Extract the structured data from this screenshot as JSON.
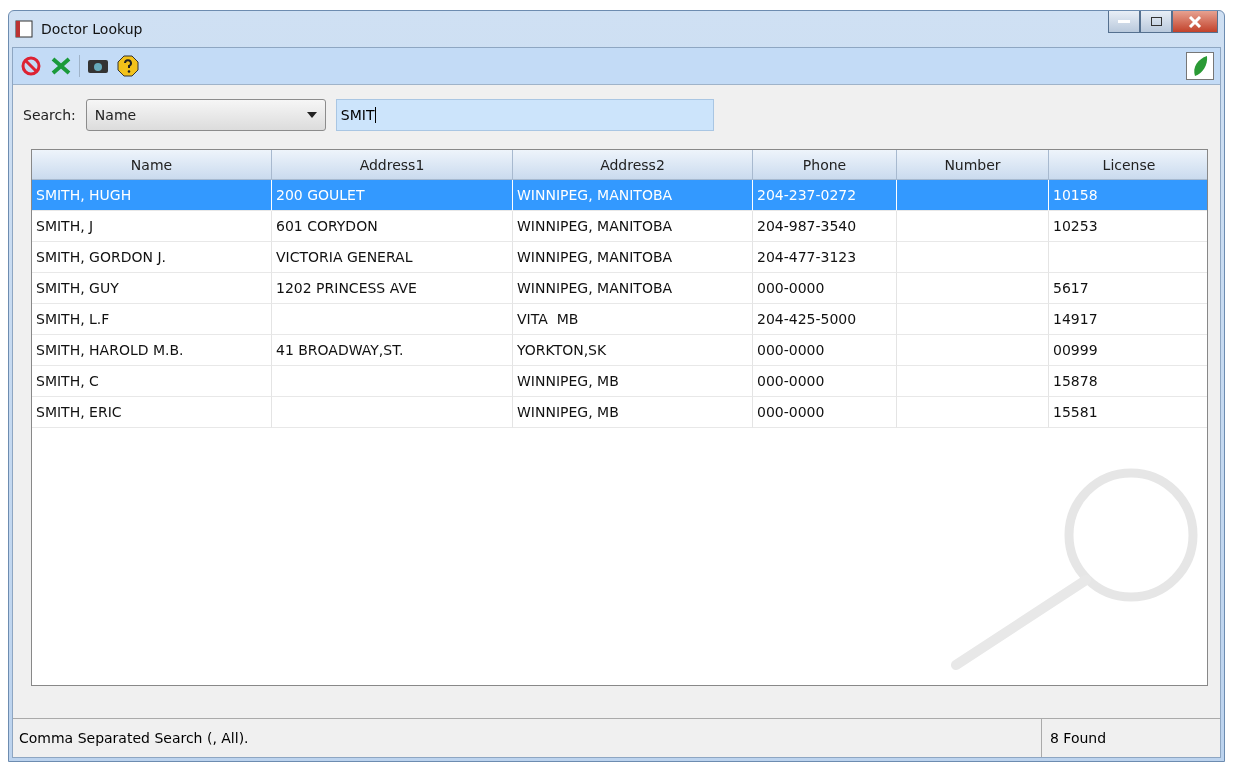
{
  "window": {
    "title": "Doctor Lookup"
  },
  "search": {
    "label": "Search:",
    "field": "Name",
    "value": "SMIT"
  },
  "table": {
    "columns": [
      "Name",
      "Address1",
      "Address2",
      "Phone",
      "Number",
      "License"
    ],
    "rows": [
      {
        "selected": true,
        "cells": [
          "SMITH, HUGH",
          "200 GOULET",
          "WINNIPEG, MANITOBA",
          "204-237-0272",
          "",
          "10158"
        ]
      },
      {
        "selected": false,
        "cells": [
          "SMITH, J",
          "601 CORYDON",
          "WINNIPEG, MANITOBA",
          "204-987-3540",
          "",
          "10253"
        ]
      },
      {
        "selected": false,
        "cells": [
          "SMITH, GORDON J.",
          "VICTORIA GENERAL",
          "WINNIPEG, MANITOBA",
          "204-477-3123",
          "",
          ""
        ]
      },
      {
        "selected": false,
        "cells": [
          "SMITH, GUY",
          "1202 PRINCESS AVE",
          "WINNIPEG, MANITOBA",
          "000-0000",
          "",
          "5617"
        ]
      },
      {
        "selected": false,
        "cells": [
          "SMITH, L.F",
          "",
          "VITA  MB",
          "204-425-5000",
          "",
          "14917"
        ]
      },
      {
        "selected": false,
        "cells": [
          "SMITH, HAROLD M.B.",
          "41 BROADWAY,ST.",
          "YORKTON,SK",
          "000-0000",
          "",
          "00999"
        ]
      },
      {
        "selected": false,
        "cells": [
          "SMITH, C",
          "",
          "WINNIPEG, MB",
          "000-0000",
          "",
          "15878"
        ]
      },
      {
        "selected": false,
        "cells": [
          "SMITH, ERIC",
          "",
          "WINNIPEG, MB",
          "000-0000",
          "",
          "15581"
        ]
      }
    ]
  },
  "status_bar": {
    "message": "Comma Separated Search (, All).",
    "count": "8 Found"
  }
}
